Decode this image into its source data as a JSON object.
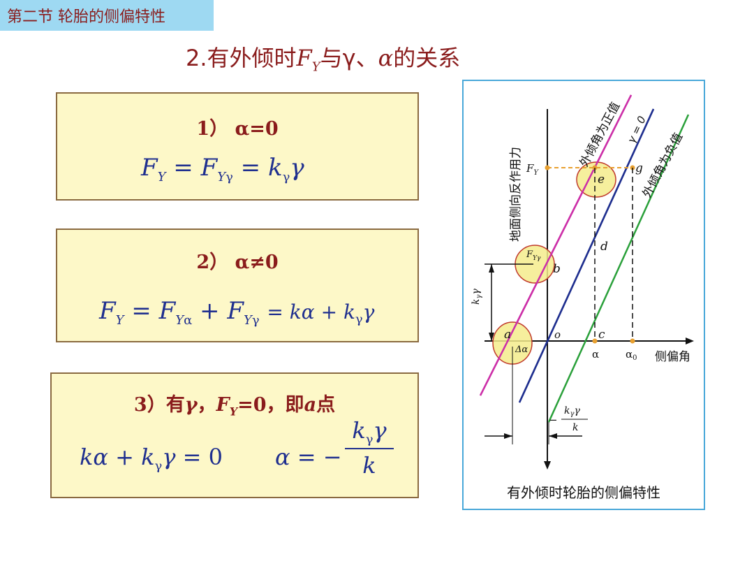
{
  "header": {
    "section_tab": "第二节  轮胎的侧偏特性"
  },
  "title": {
    "prefix": "2.有外倾时",
    "var_main": "F",
    "var_sub": "Y",
    "mid": "与γ、",
    "alpha": "α",
    "suffix": "的关系"
  },
  "case1": {
    "title": "1） α=0",
    "formula": "F_Y = F_Yγ = k_γ γ"
  },
  "case2": {
    "title": "2） α≠0",
    "formula": "F_Y = F_Yα + F_Yγ = kα + k_γ γ"
  },
  "case3": {
    "title": "3）有γ，F_Y=0，即a点",
    "formula_left": "kα + k_γ γ = 0",
    "formula_right": "α = − k_γ γ / k"
  },
  "figure": {
    "y_axis_label": "地面侧向反作用力",
    "x_axis_label": "侧偏角",
    "line_positive": "外倾角为正值",
    "line_zero": "γ = 0",
    "line_negative": "外倾角为负值",
    "fy_label": "F_Y",
    "fyγ_label": "F_Yγ",
    "kγγ_label": "k_γ γ",
    "delta_alpha": "Δα",
    "frac_num": "k_γ γ",
    "frac_den": "k",
    "frac_sign": "−",
    "points": [
      "e",
      "g",
      "d",
      "b",
      "a",
      "o",
      "c"
    ],
    "x_ticks": [
      "α",
      "α_0"
    ],
    "caption": "有外倾时轮胎的侧偏特性",
    "colors": {
      "positive": "#cc2fa8",
      "zero": "#1f2f8f",
      "negative": "#2aa03a",
      "highlight": "#f5ec8c",
      "highlight_border": "#c0392b",
      "guide": "#e8a030"
    }
  }
}
